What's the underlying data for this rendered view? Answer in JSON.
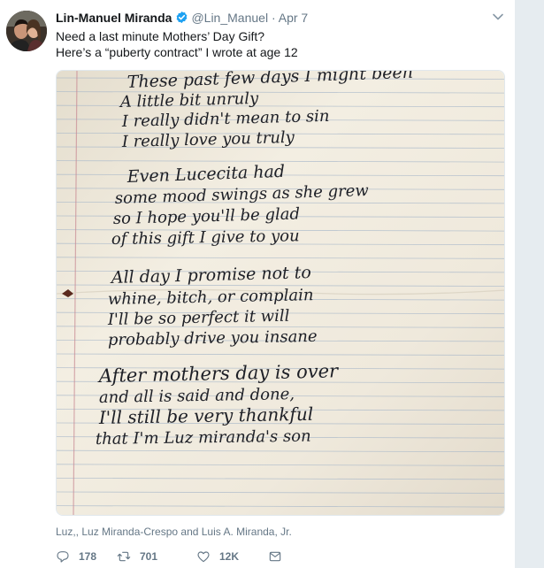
{
  "tweet": {
    "name": "Lin-Manuel Miranda",
    "handle": "@Lin_Manuel",
    "separator": "·",
    "date": "Apr 7",
    "text_line1": "Need a last minute Mothers’ Day Gift?",
    "text_line2": "Here’s a “puberty contract” I wrote at age 12",
    "tagged": "Luz,, Luz Miranda-Crespo and Luis A. Miranda, Jr.",
    "replies": "178",
    "retweets": "701",
    "likes": "12K"
  },
  "poem": {
    "lines": [
      "These past few days I might been",
      "A little bit unruly",
      "I really didn't mean to sin",
      "I really love you truly",
      "Even Lucecita had",
      "some mood swings as she grew",
      "so I hope you'll be glad",
      "of this gift I give to you",
      "All day I promise not to",
      "whine, bitch, or complain",
      "I'll be so perfect it will",
      "probably drive you insane",
      "After mothers day is over",
      "and all is said and done,",
      "I'll still be very thankful",
      "that I'm Luz miranda's son"
    ]
  },
  "colors": {
    "text": "#14171a",
    "secondary": "#657786",
    "verified": "#1da1f2",
    "paper": "#f1ecde",
    "rule": "#a7b7c9",
    "margin_line": "#c98b94",
    "ink": "#1d1f26"
  },
  "icons": [
    "verified-icon",
    "caret-down-icon",
    "reply-icon",
    "retweet-icon",
    "like-icon",
    "message-icon"
  ]
}
